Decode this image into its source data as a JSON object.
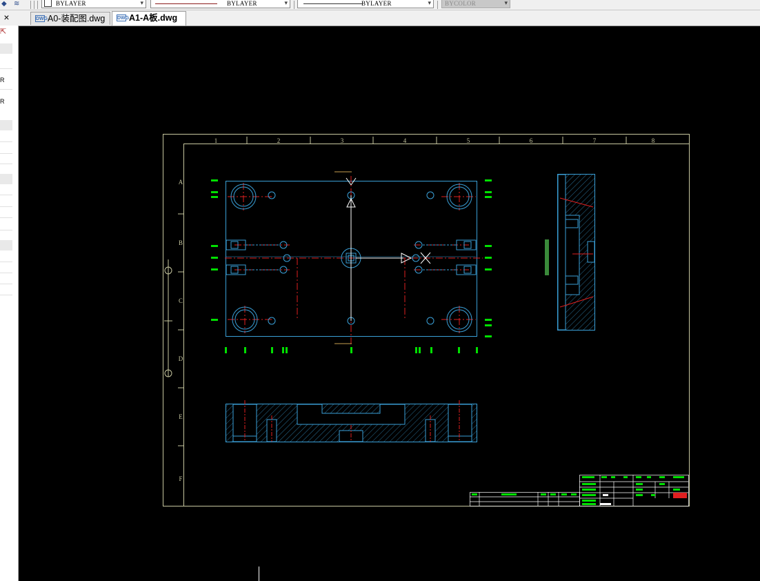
{
  "toolbar": {
    "layer_combo": "BYLAYER",
    "linetype_combo": "BYLAYER",
    "lineweight_combo": "BYLAYER",
    "color_combo": "BYCOLOR"
  },
  "tabs": [
    {
      "label": "A0-装配图.dwg",
      "active": false
    },
    {
      "label": "A1-A板.dwg",
      "active": true
    }
  ],
  "file_icon_text": "DWG",
  "close_symbol": "×",
  "left_panel": {
    "items": [
      "R",
      "R"
    ]
  },
  "drawing": {
    "border_color": "#c8c8a0",
    "model_color": "#3aa0d8",
    "centerline_color": "#e02020",
    "dimension_color": "#00e000",
    "column_labels": [
      "1",
      "2",
      "3",
      "4",
      "5",
      "6",
      "7",
      "8"
    ],
    "row_labels": [
      "A",
      "B",
      "C",
      "D",
      "E",
      "F"
    ]
  }
}
